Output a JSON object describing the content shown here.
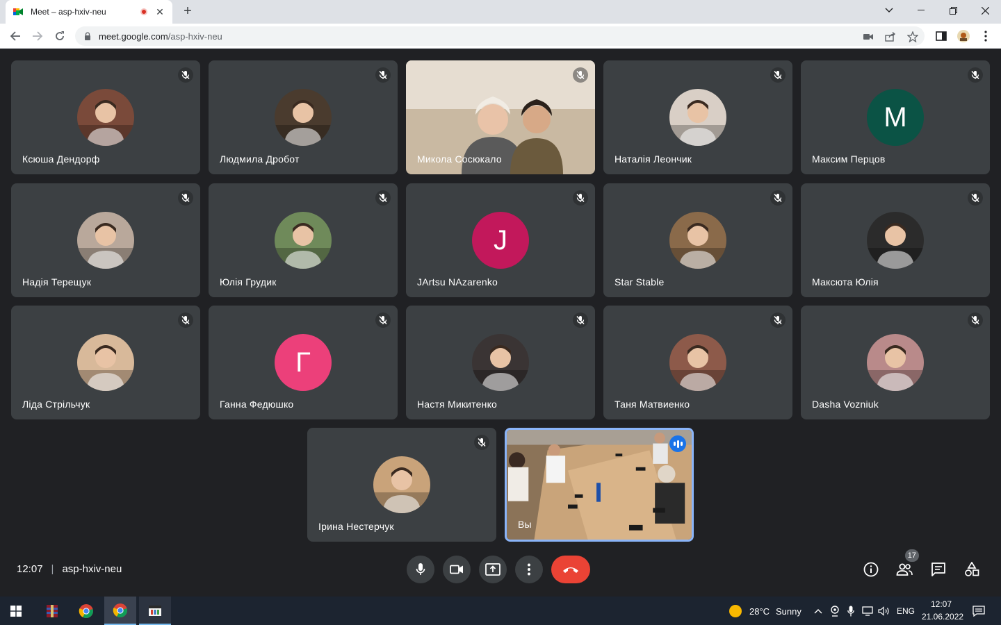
{
  "browser": {
    "tab_title": "Meet – asp-hxiv-neu",
    "url_host": "meet.google.com",
    "url_path": "/asp-hxiv-neu",
    "new_tab_label": "+"
  },
  "participants": [
    {
      "name": "Ксюша Дендорф",
      "kind": "photo",
      "color": "#7a4a3a"
    },
    {
      "name": "Людмила Дробот",
      "kind": "photo",
      "color": "#4a3b2e"
    },
    {
      "name": "Микола Сосюкало",
      "kind": "video",
      "color": "#c9b9a2"
    },
    {
      "name": "Наталія Леончик",
      "kind": "photo",
      "color": "#d9cfc6"
    },
    {
      "name": "Максим Перцов",
      "kind": "letter",
      "letter": "M",
      "color": "#0b5345"
    },
    {
      "name": "Надія Терещук",
      "kind": "photo",
      "color": "#b9a89b"
    },
    {
      "name": "Юлія Грудик",
      "kind": "photo",
      "color": "#6f8a5a"
    },
    {
      "name": "JArtsu NAzarenko",
      "kind": "letter",
      "letter": "J",
      "color": "#c2185b"
    },
    {
      "name": "Star Stable",
      "kind": "photo",
      "color": "#8a6a4a"
    },
    {
      "name": "Максюта Юлія",
      "kind": "photo",
      "color": "#2b2b2b"
    },
    {
      "name": "Ліда Стрільчук",
      "kind": "photo",
      "color": "#d8b99a"
    },
    {
      "name": "Ганна Федюшко",
      "kind": "letter",
      "letter": "Г",
      "color": "#ec407a"
    },
    {
      "name": "Настя Микитенко",
      "kind": "photo",
      "color": "#3a3434"
    },
    {
      "name": "Таня Матвиенко",
      "kind": "photo",
      "color": "#8d5a4a"
    },
    {
      "name": "Dasha Vozniuk",
      "kind": "photo",
      "color": "#b98a8a"
    },
    {
      "name": "Ірина Нестерчук",
      "kind": "photo",
      "color": "#c9a37a"
    }
  ],
  "self_tile": {
    "name": "Вы",
    "color": "#b89a72"
  },
  "meeting": {
    "time": "12:07",
    "code": "asp-hxiv-neu",
    "participant_count": "17"
  },
  "taskbar": {
    "weather_temp": "28°C",
    "weather_text": "Sunny",
    "language": "ENG",
    "time": "12:07",
    "date": "21.06.2022"
  },
  "colors": {
    "end_call": "#ea4335",
    "tile_bg": "#3c4043",
    "accent": "#8ab4f8"
  }
}
